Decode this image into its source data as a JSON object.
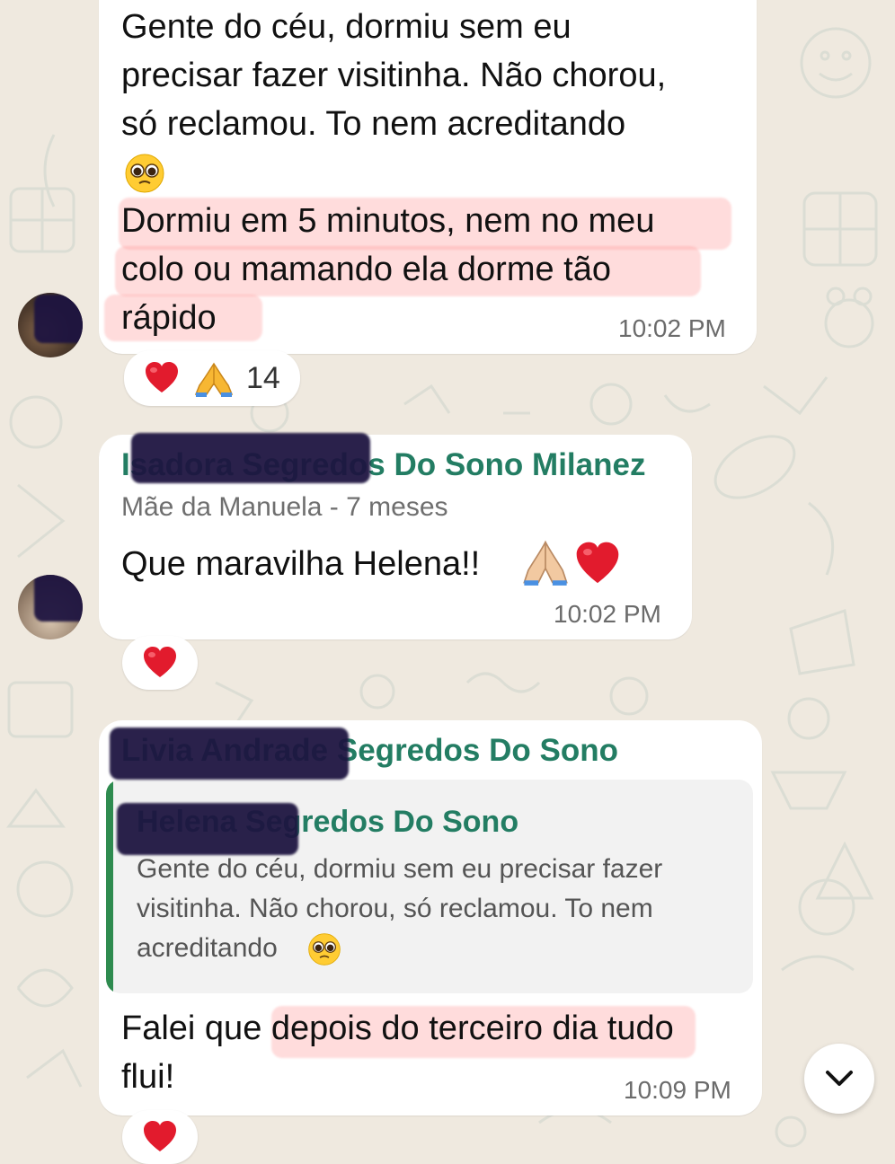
{
  "colors": {
    "chat_background": "#efe9df",
    "bubble": "#ffffff",
    "sender_name": "#237d63",
    "quote_bar": "#2e8b4f",
    "highlight": "#ff9696",
    "heart": "#e21b2d"
  },
  "messages": [
    {
      "lines": [
        "Gente do céu, dormiu sem eu",
        "precisar fazer visitinha. Não chorou,",
        "só reclamou. To nem acreditando",
        "Dormiu em 5 minutos, nem no meu",
        "colo ou mamando ela dorme tão",
        "rápido"
      ],
      "emoji": "pleading-face",
      "time": "10:02 PM",
      "reactions": {
        "icons": [
          "heart",
          "folded-hands"
        ],
        "count": "14"
      }
    },
    {
      "sender": "Isadora Segredos Do Sono Milanez",
      "subtitle": "Mãe da Manuela - 7 meses",
      "text": "Que maravilha Helena!!",
      "emojis": [
        "folded-hands",
        "heart"
      ],
      "time": "10:02 PM",
      "reactions": {
        "icons": [
          "heart"
        ]
      }
    },
    {
      "sender": "Livia Andrade Segredos Do Sono",
      "quote": {
        "sender": "Helena Segredos Do Sono",
        "lines": [
          "Gente do céu, dormiu sem eu precisar fazer",
          "visitinha. Não chorou, só reclamou. To nem",
          "acreditando"
        ],
        "emoji": "pleading-face"
      },
      "text_prefix": "Falei que",
      "text_highlight": "depois do terceiro dia tudo",
      "text_line2": "flui!",
      "time": "10:09 PM",
      "reactions": {
        "icons": [
          "heart"
        ]
      }
    }
  ],
  "scroll_button": {
    "icon": "chevron-down-icon"
  }
}
